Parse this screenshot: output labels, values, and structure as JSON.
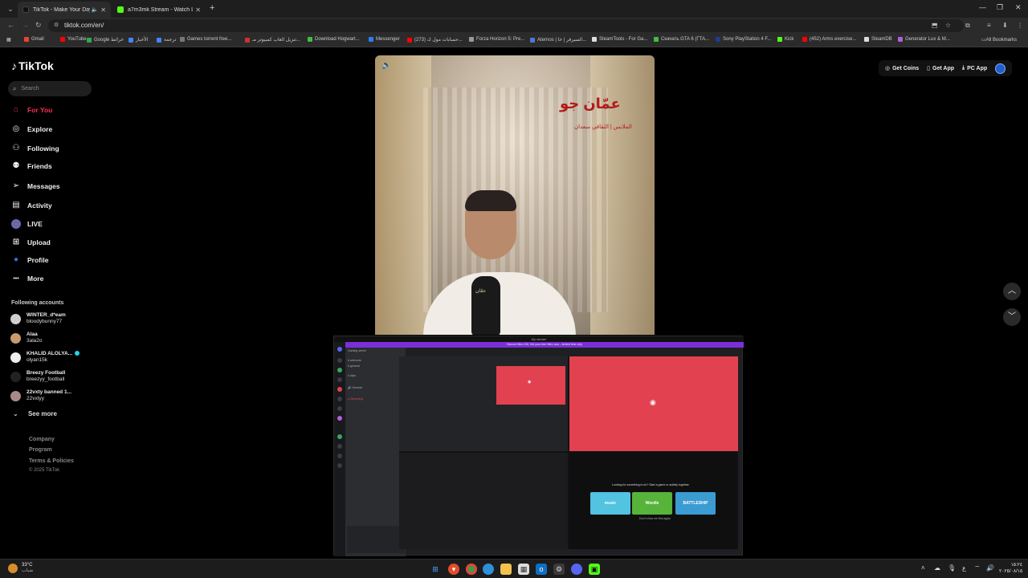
{
  "browser": {
    "tabs": [
      {
        "title": "TikTok - Make Your Day",
        "favicon_color": "#111111"
      },
      {
        "title": "a7m3mk Stream - Watch Live o",
        "favicon_color": "#53fc18"
      }
    ],
    "url": "tiktok.com/en/",
    "bookmarks": [
      {
        "label": "Gmail",
        "color": "#ea4335"
      },
      {
        "label": "YouTube",
        "color": "#ff0000"
      },
      {
        "label": "Google خرائط",
        "color": "#34a853"
      },
      {
        "label": "الأخبار",
        "color": "#4285f4"
      },
      {
        "label": "ترجمة",
        "color": "#4285f4"
      },
      {
        "label": "Games torrent free...",
        "color": "#777777"
      },
      {
        "label": "تنزيل العاب كمبيوتر مـ...",
        "color": "#cc3333"
      },
      {
        "label": "Download Hogwart...",
        "color": "#3fbf3f"
      },
      {
        "label": "Messenger",
        "color": "#2f7bf6"
      },
      {
        "label": "(273) حسابات مول ك...",
        "color": "#ff0000"
      },
      {
        "label": "Forza Horizon 5: Pre...",
        "color": "#999999"
      },
      {
        "label": "Aternos | السيرفر | خا...",
        "color": "#4a7ad6"
      },
      {
        "label": "SteamTools - For Ga...",
        "color": "#dddddd"
      },
      {
        "label": "Скачать GTA 6 (ГТА...",
        "color": "#3fbf3f"
      },
      {
        "label": "Sony PlayStation 4 F...",
        "color": "#1f3b8f"
      },
      {
        "label": "Kick",
        "color": "#53fc18"
      },
      {
        "label": "(452) Arms exercise...",
        "color": "#ff0000"
      },
      {
        "label": "SteamDB",
        "color": "#dddddd"
      },
      {
        "label": "Generator Lux & M...",
        "color": "#b55fd8"
      }
    ],
    "all_bookmarks": "All Bookmarks"
  },
  "tiktok": {
    "brand": "TikTok",
    "search_placeholder": "Search",
    "nav": [
      {
        "label": "For You",
        "icon": "home-icon",
        "active": true
      },
      {
        "label": "Explore",
        "icon": "compass-icon"
      },
      {
        "label": "Following",
        "icon": "user-plus-icon"
      },
      {
        "label": "Friends",
        "icon": "users-icon"
      },
      {
        "label": "Messages",
        "icon": "send-icon"
      },
      {
        "label": "Activity",
        "icon": "inbox-icon"
      },
      {
        "label": "LIVE",
        "icon": "live-icon"
      },
      {
        "label": "Upload",
        "icon": "plus-square-icon"
      },
      {
        "label": "Profile",
        "icon": "profile-icon"
      },
      {
        "label": "More",
        "icon": "dots-icon"
      }
    ],
    "following_title": "Following accounts",
    "accounts": [
      {
        "name": "WINTER_d*eam",
        "handle": "bloodybunny77",
        "color": "#cfcfcf"
      },
      {
        "name": "Alaa",
        "handle": "3ala2o",
        "color": "#c79a6b"
      },
      {
        "name": "KHALID ALOLYA...",
        "handle": "olyan15k",
        "color": "#eeeeee",
        "verified": true
      },
      {
        "name": "Breezy Football",
        "handle": "breezyy_football",
        "color": "#222222"
      },
      {
        "name": "22vxty banned 1...",
        "handle": "22vxtyy",
        "color": "#a88"
      }
    ],
    "see_more": "See more",
    "footer": [
      "Company",
      "Program",
      "Terms & Policies",
      "© 2025 TikTok"
    ],
    "top_right": {
      "coins": "Get Coins",
      "app": "Get App",
      "pc": "PC App"
    },
    "video": {
      "title": "عمّان جو",
      "subtitle": "الملابس | الثقافي سعدان",
      "mic_label": "عمّان"
    }
  },
  "overlay": {
    "window_title": "My stream",
    "banner": "Discord Nitro Gift: Get your free Nitro now – limited time only",
    "act_title": "Looking for something to do? Start a game or activity together",
    "cards": [
      {
        "label": "music",
        "color": "#52c3e0"
      },
      {
        "label": "Wordle",
        "color": "#57b33a"
      },
      {
        "label": "BATTLESHIP",
        "color": "#3b9bd3"
      }
    ],
    "footer": "Don't show me this again"
  },
  "taskbar": {
    "temp": "33°C",
    "weather": "ضباب",
    "time": "١٥:٢٤",
    "date": "٢٠٢٥/٠٨/١٥",
    "lang": "ع"
  }
}
